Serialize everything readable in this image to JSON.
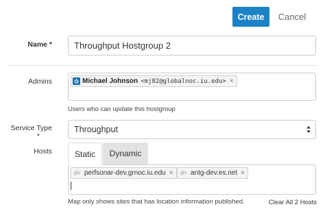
{
  "actions": {
    "create_label": "Create",
    "cancel_label": "Cancel"
  },
  "form": {
    "name": {
      "label": "Name *",
      "value": "Throughput Hostgroup 2"
    },
    "admins": {
      "label": "Admins",
      "tags": [
        {
          "name": "Michael Johnson",
          "email": "<mj82@globalnoc.iu.edu>",
          "icon": "power-icon"
        }
      ],
      "remove_glyph": "×",
      "help": "Users who can update this hostgroup"
    },
    "service_type": {
      "label_line1": "Service Type",
      "label_line2": "*",
      "selected": "Throughput"
    },
    "hosts": {
      "label": "Hosts",
      "tabs": [
        "Static",
        "Dynamic"
      ],
      "active_tab": "Static",
      "tags": [
        {
          "source": "gls",
          "name": "perfsonar-dev.grnoc.iu.edu"
        },
        {
          "source": "gls",
          "name": "antg-dev.es.net"
        }
      ],
      "remove_glyph": "×",
      "map_note": "Map only shows sites that has location information published.",
      "clear_all_label": "Clear All 2 Hosts"
    }
  },
  "colors": {
    "primary": "#1a82c5",
    "power_icon": "#1a6fa8"
  }
}
